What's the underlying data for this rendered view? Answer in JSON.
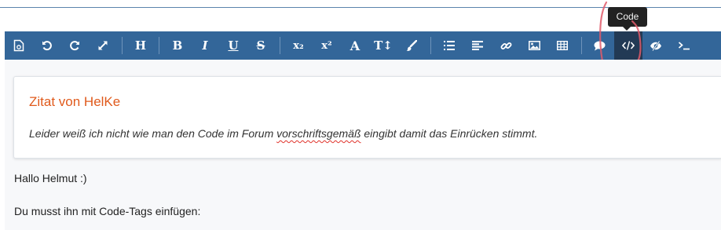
{
  "tooltip": {
    "text": "Code"
  },
  "toolbar": {
    "buttons": [
      {
        "name": "source-mode-button",
        "icon": "source-document-icon"
      },
      {
        "name": "undo-button",
        "icon": "undo-icon"
      },
      {
        "name": "redo-button",
        "icon": "redo-icon"
      },
      {
        "name": "fullscreen-button",
        "icon": "expand-icon"
      },
      {
        "name": "heading-button",
        "label": "H"
      },
      {
        "name": "bold-button",
        "label": "B"
      },
      {
        "name": "italic-button",
        "label": "I"
      },
      {
        "name": "underline-button",
        "label": "U"
      },
      {
        "name": "strikethrough-button",
        "label": "S"
      },
      {
        "name": "subscript-button",
        "label": "x₂"
      },
      {
        "name": "superscript-button",
        "label": "x²"
      },
      {
        "name": "font-color-button",
        "label": "A"
      },
      {
        "name": "font-size-button",
        "label": "T↕"
      },
      {
        "name": "paint-button",
        "icon": "brush-icon"
      },
      {
        "name": "list-button",
        "icon": "list-icon"
      },
      {
        "name": "align-button",
        "icon": "align-left-icon"
      },
      {
        "name": "link-button",
        "icon": "link-icon"
      },
      {
        "name": "image-button",
        "icon": "image-icon"
      },
      {
        "name": "table-button",
        "icon": "table-icon"
      },
      {
        "name": "quote-button",
        "icon": "speech-bubble-icon"
      },
      {
        "name": "code-button",
        "icon": "code-icon",
        "active": true
      },
      {
        "name": "spoiler-button",
        "icon": "eye-slash-icon"
      },
      {
        "name": "inline-code-button",
        "icon": "terminal-icon"
      }
    ],
    "colors": {
      "bar": "#336699",
      "active": "#223a55",
      "icon": "#ffffff"
    }
  },
  "annotation": {
    "color": "#e05a6a",
    "shape": "hand-drawn-circle"
  },
  "editor": {
    "quote": {
      "title": "Zitat von HelKe",
      "text_before": "Leider weiß ich nicht wie man den Code im Forum ",
      "text_misspelled": "vorschriftsgemäß",
      "text_after": " eingibt damit das Einrücken stimmt."
    },
    "paragraphs": [
      "Hallo Helmut :)",
      "Du musst ihn mit Code-Tags einfügen:"
    ]
  }
}
